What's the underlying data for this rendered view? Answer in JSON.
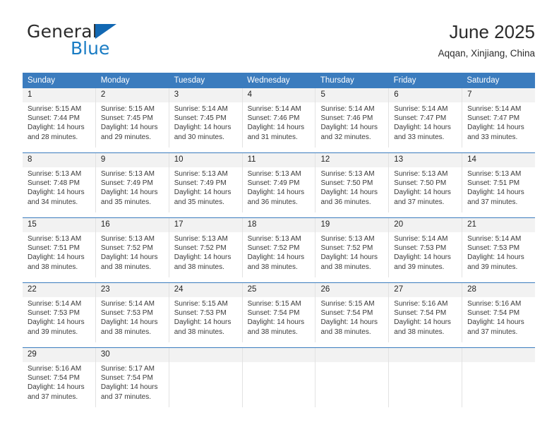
{
  "logo": {
    "word1": "General",
    "word2": "Blue",
    "triangle": "blue-triangle-icon",
    "color": "#1268b3"
  },
  "header": {
    "title": "June 2025",
    "location": "Aqqan, Xinjiang, China"
  },
  "theme": {
    "header_blue": "#3b7cbe",
    "daynum_gray": "#f2f2f2",
    "text": "#3a3a3a"
  },
  "weekdays": [
    "Sunday",
    "Monday",
    "Tuesday",
    "Wednesday",
    "Thursday",
    "Friday",
    "Saturday"
  ],
  "weeks": [
    [
      {
        "day": "1",
        "sunrise": "Sunrise: 5:15 AM",
        "sunset": "Sunset: 7:44 PM",
        "daylight1": "Daylight: 14 hours",
        "daylight2": "and 28 minutes."
      },
      {
        "day": "2",
        "sunrise": "Sunrise: 5:15 AM",
        "sunset": "Sunset: 7:45 PM",
        "daylight1": "Daylight: 14 hours",
        "daylight2": "and 29 minutes."
      },
      {
        "day": "3",
        "sunrise": "Sunrise: 5:14 AM",
        "sunset": "Sunset: 7:45 PM",
        "daylight1": "Daylight: 14 hours",
        "daylight2": "and 30 minutes."
      },
      {
        "day": "4",
        "sunrise": "Sunrise: 5:14 AM",
        "sunset": "Sunset: 7:46 PM",
        "daylight1": "Daylight: 14 hours",
        "daylight2": "and 31 minutes."
      },
      {
        "day": "5",
        "sunrise": "Sunrise: 5:14 AM",
        "sunset": "Sunset: 7:46 PM",
        "daylight1": "Daylight: 14 hours",
        "daylight2": "and 32 minutes."
      },
      {
        "day": "6",
        "sunrise": "Sunrise: 5:14 AM",
        "sunset": "Sunset: 7:47 PM",
        "daylight1": "Daylight: 14 hours",
        "daylight2": "and 33 minutes."
      },
      {
        "day": "7",
        "sunrise": "Sunrise: 5:14 AM",
        "sunset": "Sunset: 7:47 PM",
        "daylight1": "Daylight: 14 hours",
        "daylight2": "and 33 minutes."
      }
    ],
    [
      {
        "day": "8",
        "sunrise": "Sunrise: 5:13 AM",
        "sunset": "Sunset: 7:48 PM",
        "daylight1": "Daylight: 14 hours",
        "daylight2": "and 34 minutes."
      },
      {
        "day": "9",
        "sunrise": "Sunrise: 5:13 AM",
        "sunset": "Sunset: 7:49 PM",
        "daylight1": "Daylight: 14 hours",
        "daylight2": "and 35 minutes."
      },
      {
        "day": "10",
        "sunrise": "Sunrise: 5:13 AM",
        "sunset": "Sunset: 7:49 PM",
        "daylight1": "Daylight: 14 hours",
        "daylight2": "and 35 minutes."
      },
      {
        "day": "11",
        "sunrise": "Sunrise: 5:13 AM",
        "sunset": "Sunset: 7:49 PM",
        "daylight1": "Daylight: 14 hours",
        "daylight2": "and 36 minutes."
      },
      {
        "day": "12",
        "sunrise": "Sunrise: 5:13 AM",
        "sunset": "Sunset: 7:50 PM",
        "daylight1": "Daylight: 14 hours",
        "daylight2": "and 36 minutes."
      },
      {
        "day": "13",
        "sunrise": "Sunrise: 5:13 AM",
        "sunset": "Sunset: 7:50 PM",
        "daylight1": "Daylight: 14 hours",
        "daylight2": "and 37 minutes."
      },
      {
        "day": "14",
        "sunrise": "Sunrise: 5:13 AM",
        "sunset": "Sunset: 7:51 PM",
        "daylight1": "Daylight: 14 hours",
        "daylight2": "and 37 minutes."
      }
    ],
    [
      {
        "day": "15",
        "sunrise": "Sunrise: 5:13 AM",
        "sunset": "Sunset: 7:51 PM",
        "daylight1": "Daylight: 14 hours",
        "daylight2": "and 38 minutes."
      },
      {
        "day": "16",
        "sunrise": "Sunrise: 5:13 AM",
        "sunset": "Sunset: 7:52 PM",
        "daylight1": "Daylight: 14 hours",
        "daylight2": "and 38 minutes."
      },
      {
        "day": "17",
        "sunrise": "Sunrise: 5:13 AM",
        "sunset": "Sunset: 7:52 PM",
        "daylight1": "Daylight: 14 hours",
        "daylight2": "and 38 minutes."
      },
      {
        "day": "18",
        "sunrise": "Sunrise: 5:13 AM",
        "sunset": "Sunset: 7:52 PM",
        "daylight1": "Daylight: 14 hours",
        "daylight2": "and 38 minutes."
      },
      {
        "day": "19",
        "sunrise": "Sunrise: 5:13 AM",
        "sunset": "Sunset: 7:52 PM",
        "daylight1": "Daylight: 14 hours",
        "daylight2": "and 38 minutes."
      },
      {
        "day": "20",
        "sunrise": "Sunrise: 5:14 AM",
        "sunset": "Sunset: 7:53 PM",
        "daylight1": "Daylight: 14 hours",
        "daylight2": "and 39 minutes."
      },
      {
        "day": "21",
        "sunrise": "Sunrise: 5:14 AM",
        "sunset": "Sunset: 7:53 PM",
        "daylight1": "Daylight: 14 hours",
        "daylight2": "and 39 minutes."
      }
    ],
    [
      {
        "day": "22",
        "sunrise": "Sunrise: 5:14 AM",
        "sunset": "Sunset: 7:53 PM",
        "daylight1": "Daylight: 14 hours",
        "daylight2": "and 39 minutes."
      },
      {
        "day": "23",
        "sunrise": "Sunrise: 5:14 AM",
        "sunset": "Sunset: 7:53 PM",
        "daylight1": "Daylight: 14 hours",
        "daylight2": "and 38 minutes."
      },
      {
        "day": "24",
        "sunrise": "Sunrise: 5:15 AM",
        "sunset": "Sunset: 7:53 PM",
        "daylight1": "Daylight: 14 hours",
        "daylight2": "and 38 minutes."
      },
      {
        "day": "25",
        "sunrise": "Sunrise: 5:15 AM",
        "sunset": "Sunset: 7:54 PM",
        "daylight1": "Daylight: 14 hours",
        "daylight2": "and 38 minutes."
      },
      {
        "day": "26",
        "sunrise": "Sunrise: 5:15 AM",
        "sunset": "Sunset: 7:54 PM",
        "daylight1": "Daylight: 14 hours",
        "daylight2": "and 38 minutes."
      },
      {
        "day": "27",
        "sunrise": "Sunrise: 5:16 AM",
        "sunset": "Sunset: 7:54 PM",
        "daylight1": "Daylight: 14 hours",
        "daylight2": "and 38 minutes."
      },
      {
        "day": "28",
        "sunrise": "Sunrise: 5:16 AM",
        "sunset": "Sunset: 7:54 PM",
        "daylight1": "Daylight: 14 hours",
        "daylight2": "and 37 minutes."
      }
    ],
    [
      {
        "day": "29",
        "sunrise": "Sunrise: 5:16 AM",
        "sunset": "Sunset: 7:54 PM",
        "daylight1": "Daylight: 14 hours",
        "daylight2": "and 37 minutes."
      },
      {
        "day": "30",
        "sunrise": "Sunrise: 5:17 AM",
        "sunset": "Sunset: 7:54 PM",
        "daylight1": "Daylight: 14 hours",
        "daylight2": "and 37 minutes."
      },
      {
        "day": "",
        "sunrise": "",
        "sunset": "",
        "daylight1": "",
        "daylight2": ""
      },
      {
        "day": "",
        "sunrise": "",
        "sunset": "",
        "daylight1": "",
        "daylight2": ""
      },
      {
        "day": "",
        "sunrise": "",
        "sunset": "",
        "daylight1": "",
        "daylight2": ""
      },
      {
        "day": "",
        "sunrise": "",
        "sunset": "",
        "daylight1": "",
        "daylight2": ""
      },
      {
        "day": "",
        "sunrise": "",
        "sunset": "",
        "daylight1": "",
        "daylight2": ""
      }
    ]
  ]
}
